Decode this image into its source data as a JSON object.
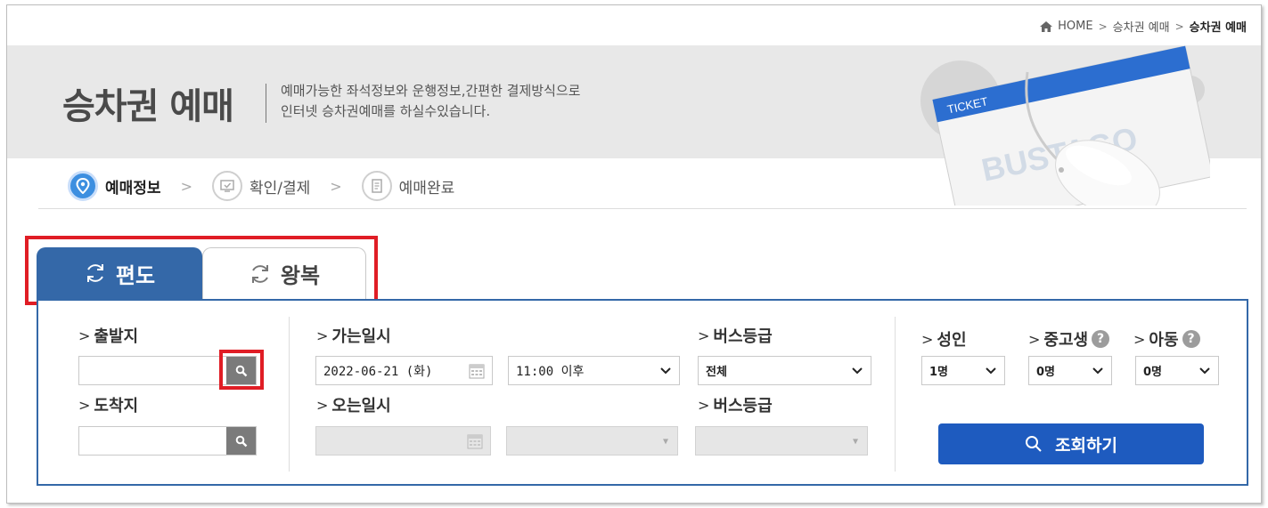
{
  "breadcrumb": {
    "home": "HOME",
    "section": "승차권 예매",
    "current": "승차권 예매"
  },
  "banner": {
    "title": "승차권 예매",
    "desc_line1": "예매가능한 좌석정보와 운행정보,간편한 결제방식으로",
    "desc_line2": "인터넷 승차권예매를 하실수있습니다.",
    "art_ticket": "TICKET",
    "art_brand": "BUSTAGO"
  },
  "steps": [
    {
      "label": "예매정보",
      "state": "active"
    },
    {
      "label": "확인/결제",
      "state": "inactive"
    },
    {
      "label": "예매완료",
      "state": "inactive"
    }
  ],
  "tabs": {
    "oneway": "편도",
    "roundtrip": "왕복",
    "active": "oneway"
  },
  "form": {
    "departure_label": "출발지",
    "departure_value": "",
    "arrival_label": "도착지",
    "arrival_value": "",
    "go_date_label": "가는일시",
    "go_date": "2022-06-21 (화)",
    "go_time": "11:00 이후",
    "go_grade_label": "버스등급",
    "go_grade": "전체",
    "return_date_label": "오는일시",
    "return_grade_label": "버스등급",
    "adult_label": "성인",
    "adult_value": "1명",
    "student_label": "중고생",
    "student_value": "0명",
    "child_label": "아동",
    "child_value": "0명",
    "search_button": "조회하기"
  },
  "colors": {
    "primary": "#3468a8",
    "button": "#1e5bbf",
    "highlight": "#e01d25",
    "step_active": "#3d8fe0"
  }
}
